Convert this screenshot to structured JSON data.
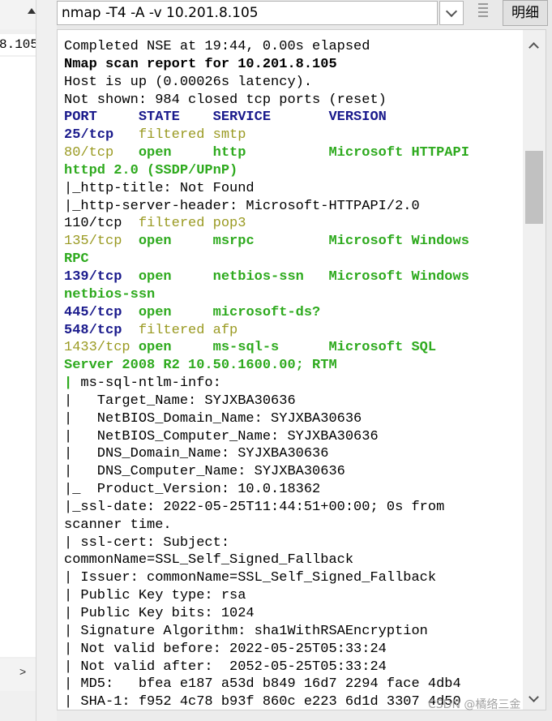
{
  "toolbar": {
    "command": "nmap -T4 -A -v 10.201.8.105",
    "detail_button": "明细"
  },
  "left_panel": {
    "target_fragment": "8.105"
  },
  "colors": {
    "default": "#000000",
    "port_blue": "#1a1a8c",
    "filtered": "#9a9a22",
    "open": "#2eaa1e",
    "header": "#1a1a8c"
  },
  "output_lines": [
    [
      {
        "t": "Completed NSE at 19:44, 0.00s elapsed",
        "c": "default"
      }
    ],
    [
      {
        "t": "Nmap scan report for 10.201.",
        "c": "default",
        "b": true
      },
      {
        "t": "8",
        "c": "default",
        "b": true
      },
      {
        "t": ".105",
        "c": "default",
        "b": true
      }
    ],
    [
      {
        "t": "Host is up (0.00026s latency).",
        "c": "default"
      }
    ],
    [
      {
        "t": "Not shown: 984 closed tcp ports (reset)",
        "c": "default"
      }
    ],
    [
      {
        "t": "PORT     STATE    SERVICE       VERSION",
        "c": "header",
        "b": true
      }
    ],
    [
      {
        "t": "25/tcp",
        "c": "port_blue",
        "b": true
      },
      {
        "t": "   filtered smtp",
        "c": "filtered"
      }
    ],
    [
      {
        "t": "80/tcp",
        "c": "filtered"
      },
      {
        "t": "   open     http          Microsoft HTTPAPI",
        "c": "open",
        "b": true
      }
    ],
    [
      {
        "t": "httpd 2.0 (SSDP/UPnP)",
        "c": "open",
        "b": true
      }
    ],
    [
      {
        "t": "|_http-title: Not Found",
        "c": "default"
      }
    ],
    [
      {
        "t": "|_http-server-header: Microsoft-HTTPAPI/2.0",
        "c": "default"
      }
    ],
    [
      {
        "t": "110/tcp",
        "c": "default"
      },
      {
        "t": "  filtered pop3",
        "c": "filtered"
      }
    ],
    [
      {
        "t": "135/tcp",
        "c": "filtered"
      },
      {
        "t": "  open     msrpc         Microsoft Windows",
        "c": "open",
        "b": true
      }
    ],
    [
      {
        "t": "RPC",
        "c": "open",
        "b": true
      }
    ],
    [
      {
        "t": "139/tcp",
        "c": "port_blue",
        "b": true
      },
      {
        "t": "  open     netbios-ssn   Microsoft Windows",
        "c": "open",
        "b": true
      }
    ],
    [
      {
        "t": "netbios-ssn",
        "c": "open",
        "b": true
      }
    ],
    [
      {
        "t": "445/tcp",
        "c": "port_blue",
        "b": true
      },
      {
        "t": "  open     microsoft-ds?",
        "c": "open",
        "b": true
      }
    ],
    [
      {
        "t": "548/tcp",
        "c": "port_blue",
        "b": true
      },
      {
        "t": "  filtered afp",
        "c": "filtered"
      }
    ],
    [
      {
        "t": "1433/tcp",
        "c": "filtered"
      },
      {
        "t": " open     ms-sql-s      Microsoft SQL",
        "c": "open",
        "b": true
      }
    ],
    [
      {
        "t": "Server 2008 R2 10.50.1600.00; RTM",
        "c": "open",
        "b": true
      }
    ],
    [
      {
        "t": "| ",
        "c": "open",
        "b": true
      },
      {
        "t": "ms-sql-ntlm-info:",
        "c": "default"
      }
    ],
    [
      {
        "t": "|   Target_Name: SYJXBA30636",
        "c": "default"
      }
    ],
    [
      {
        "t": "|   NetBIOS_Domain_Name: SYJXBA30636",
        "c": "default"
      }
    ],
    [
      {
        "t": "|   NetBIOS_Computer_Name: SYJXBA30636",
        "c": "default"
      }
    ],
    [
      {
        "t": "|   DNS_Domain_Name: SYJXBA30636",
        "c": "default"
      }
    ],
    [
      {
        "t": "|   DNS_Computer_Name: SYJXBA30636",
        "c": "default"
      }
    ],
    [
      {
        "t": "|_  Product_Version: 10.0.18362",
        "c": "default"
      }
    ],
    [
      {
        "t": "|_ssl-date: 2022-05-25T11:44:51+00:00; 0s from",
        "c": "default"
      }
    ],
    [
      {
        "t": "scanner time.",
        "c": "default"
      }
    ],
    [
      {
        "t": "| ssl-cert: Subject:",
        "c": "default"
      }
    ],
    [
      {
        "t": "commonName=SSL_Self_Signed_Fallback",
        "c": "default"
      }
    ],
    [
      {
        "t": "| Issuer: commonName=SSL_Self_Signed_Fallback",
        "c": "default"
      }
    ],
    [
      {
        "t": "| Public Key type: rsa",
        "c": "default"
      }
    ],
    [
      {
        "t": "| Public Key bits: 1024",
        "c": "default"
      }
    ],
    [
      {
        "t": "| Signature Algorithm: sha1WithRSAEncryption",
        "c": "default"
      }
    ],
    [
      {
        "t": "| Not valid before: 2022-05-25T05:33:24",
        "c": "default"
      }
    ],
    [
      {
        "t": "| Not valid after:  2052-05-25T05:33:24",
        "c": "default"
      }
    ],
    [
      {
        "t": "| MD5:   bfea e187 a53d b849 16d7 2294 face 4db4",
        "c": "default"
      }
    ],
    [
      {
        "t": "| SHA-1: f952 4c78 b93f 860c e223 6d1d 3307 4d50",
        "c": "default"
      }
    ]
  ],
  "watermark": "CSDN @橘络三金"
}
